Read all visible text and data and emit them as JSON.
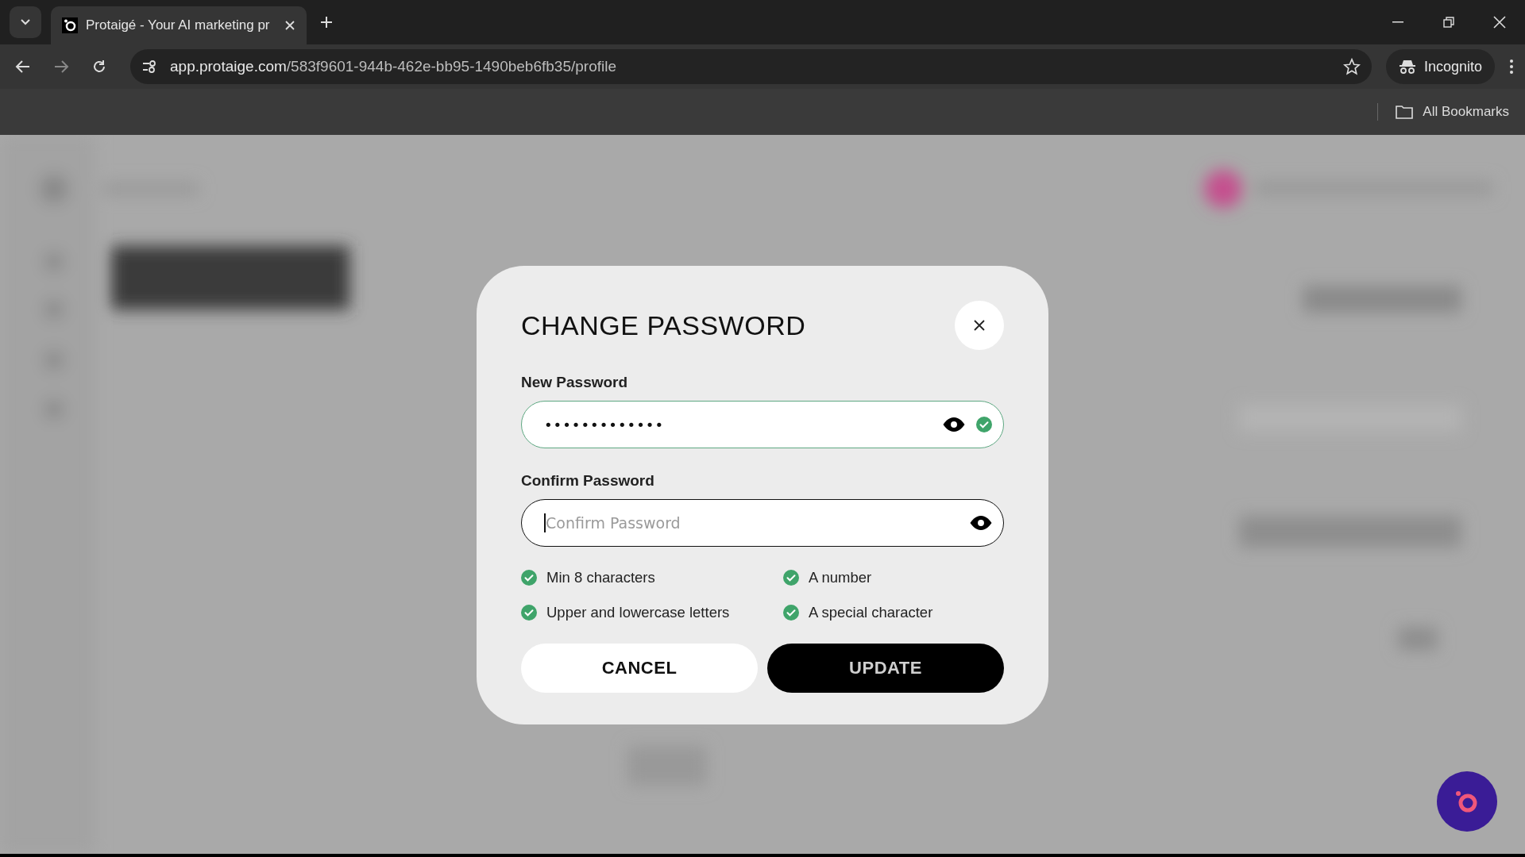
{
  "browser": {
    "tabs": [
      {
        "title": "Protaigé - Your AI marketing pr",
        "selected": true
      }
    ],
    "url_host": "app.protaige.com",
    "url_path": "/583f9601-944b-462e-bb95-1490beb6fb35/profile",
    "incognito_label": "Incognito",
    "bookmarks_label": "All Bookmarks"
  },
  "dialog": {
    "title": "CHANGE PASSWORD",
    "fields": [
      {
        "label": "New Password",
        "value": "•••••••••••••",
        "valid": true,
        "focused": false
      },
      {
        "label": "Confirm Password",
        "placeholder": "Confirm Password",
        "valid": false,
        "focused": true
      }
    ],
    "requirements": [
      {
        "text": "Min 8 characters",
        "met": true
      },
      {
        "text": "A number",
        "met": true
      },
      {
        "text": "Upper and lowercase letters",
        "met": true
      },
      {
        "text": "A special character",
        "met": true
      }
    ],
    "buttons": [
      {
        "label": "CANCEL",
        "kind": "secondary"
      },
      {
        "label": "UPDATE",
        "kind": "primary"
      }
    ]
  }
}
